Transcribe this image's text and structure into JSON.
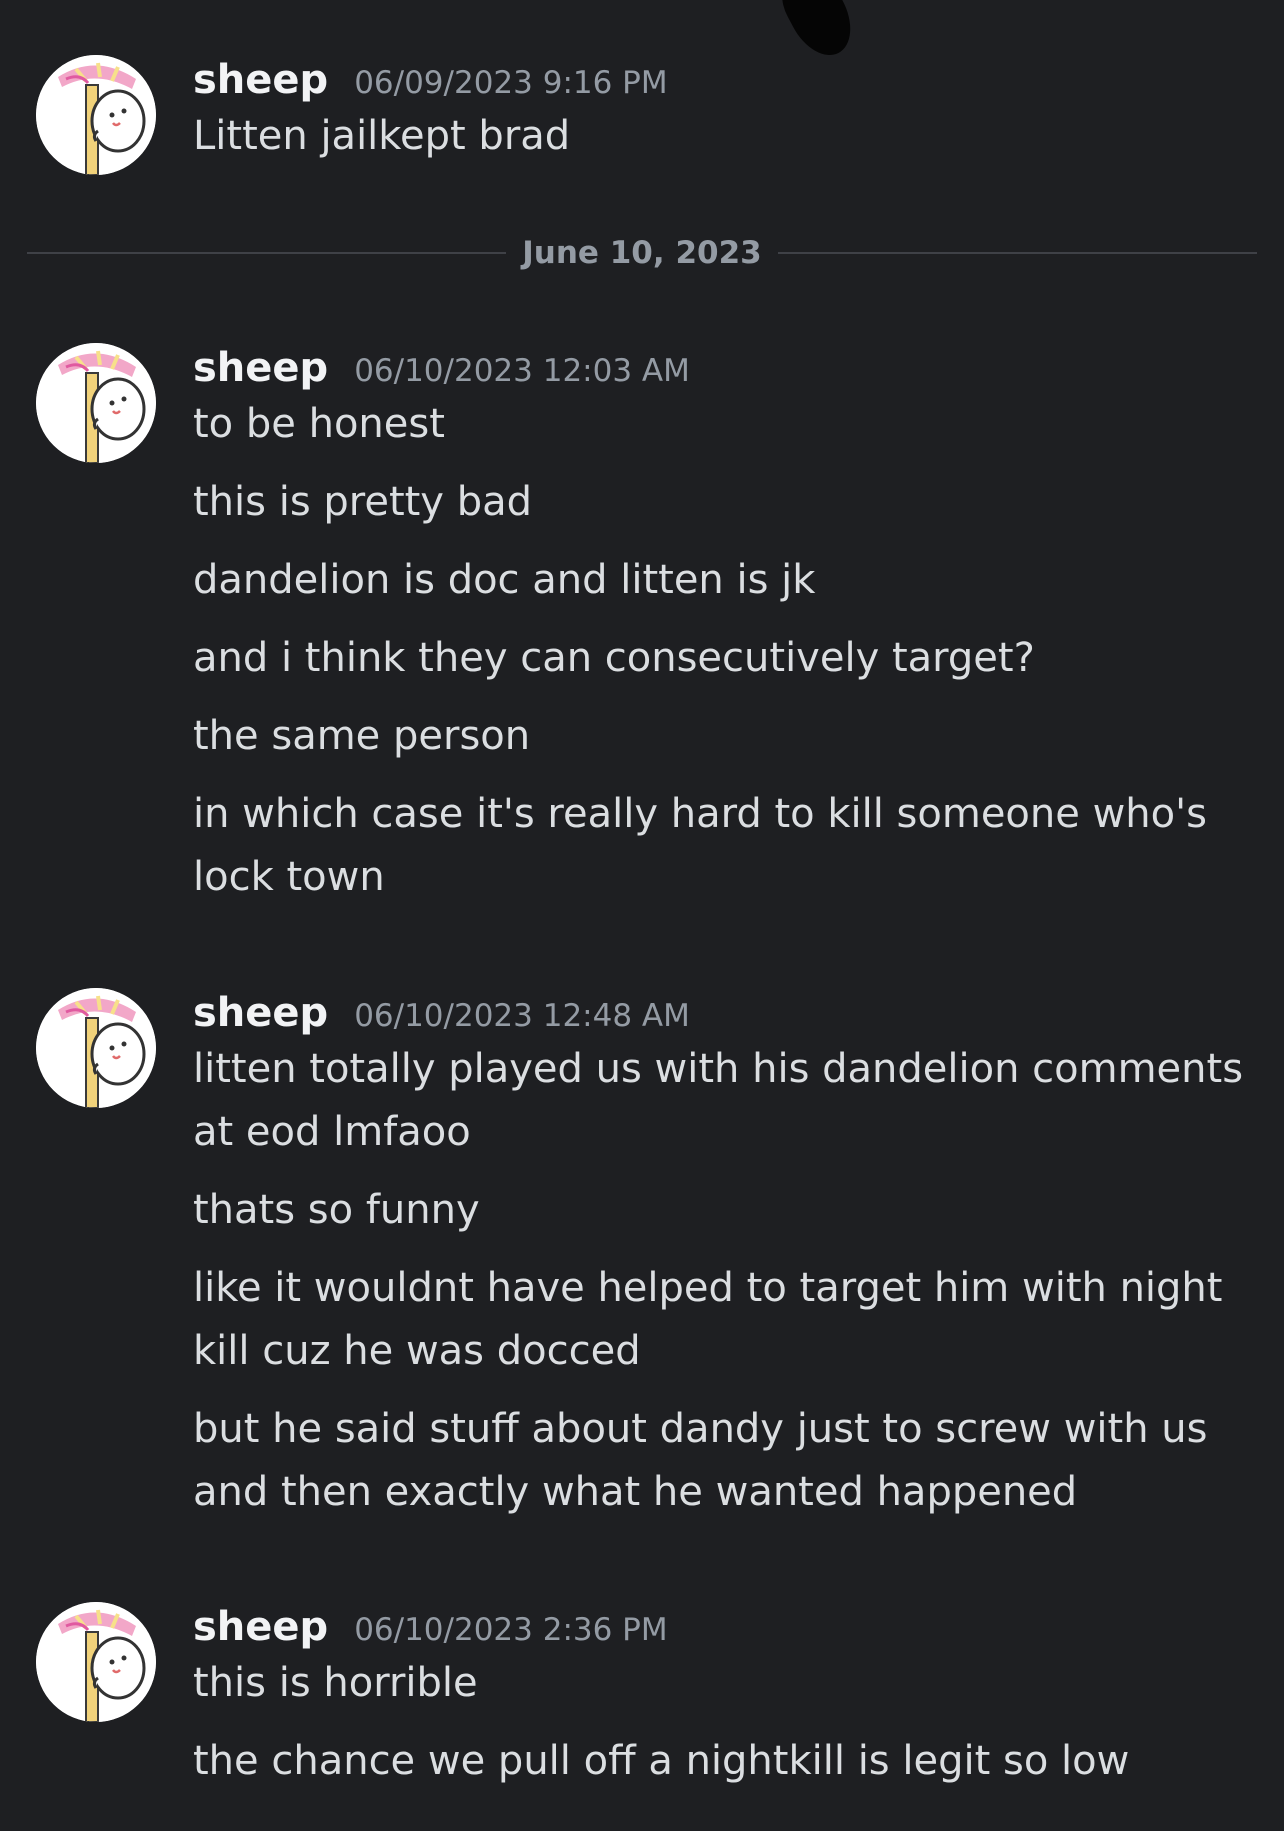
{
  "colors": {
    "background": "#1e1f22",
    "text": "#dbdee1",
    "author": "#f2f3f5",
    "muted": "#949ba4",
    "divider": "#3f4147"
  },
  "divider": {
    "label": "June 10, 2023"
  },
  "messages": [
    {
      "author": "sheep",
      "timestamp": "06/09/2023 9:16 PM",
      "lines": [
        "Litten jailkept brad"
      ]
    },
    {
      "author": "sheep",
      "timestamp": "06/10/2023 12:03 AM",
      "lines": [
        "to be honest",
        "this is pretty bad",
        "dandelion is doc and litten is jk",
        "and i think they can consecutively target?",
        "the same person",
        "in which case it's really hard to kill someone who's lock town"
      ]
    },
    {
      "author": "sheep",
      "timestamp": "06/10/2023 12:48 AM",
      "lines": [
        "litten totally played us with his dandelion comments at eod lmfaoo",
        "thats so funny",
        "like it wouldnt have helped to target him with night kill cuz he was docced",
        "but he said stuff about dandy just to screw with us and then exactly what he wanted happened"
      ]
    },
    {
      "author": "sheep",
      "timestamp": "06/10/2023 2:36 PM",
      "lines": [
        "this is horrible",
        "the chance we pull off a nightkill is legit so low"
      ]
    }
  ]
}
